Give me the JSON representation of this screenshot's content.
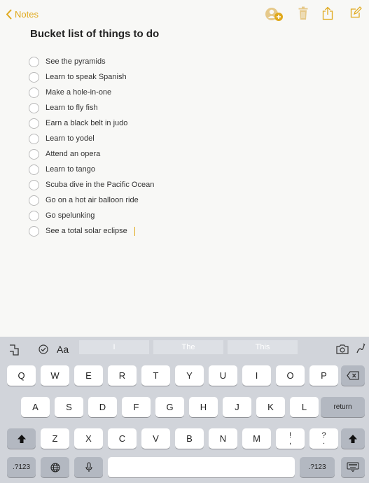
{
  "nav": {
    "back_label": "Notes"
  },
  "note": {
    "title": "Bucket list of things to do",
    "items": [
      "See the pyramids",
      "Learn to speak Spanish",
      "Make a hole-in-one",
      "Learn to fly fish",
      "Earn a black belt in judo",
      "Learn to yodel",
      "Attend an opera",
      "Learn to tango",
      "Scuba dive in the Pacific Ocean",
      "Go on a hot air balloon ride",
      "Go spelunking",
      "See a total solar eclipse"
    ]
  },
  "quicktype": {
    "format_label": "Aa",
    "suggestions": [
      "I",
      "The",
      "This"
    ]
  },
  "keyboard": {
    "row1": [
      "Q",
      "W",
      "E",
      "R",
      "T",
      "Y",
      "U",
      "I",
      "O",
      "P"
    ],
    "row2": [
      "A",
      "S",
      "D",
      "F",
      "G",
      "H",
      "J",
      "K",
      "L"
    ],
    "row3": [
      "Z",
      "X",
      "C",
      "V",
      "B",
      "N",
      "M"
    ],
    "row3_punct": [
      [
        "!",
        ","
      ],
      [
        "?",
        "."
      ]
    ],
    "return_label": "return",
    "numbers_label": ".?123"
  },
  "colors": {
    "accent": "#e0a91c",
    "keyboard_bg": "#d1d4da"
  }
}
